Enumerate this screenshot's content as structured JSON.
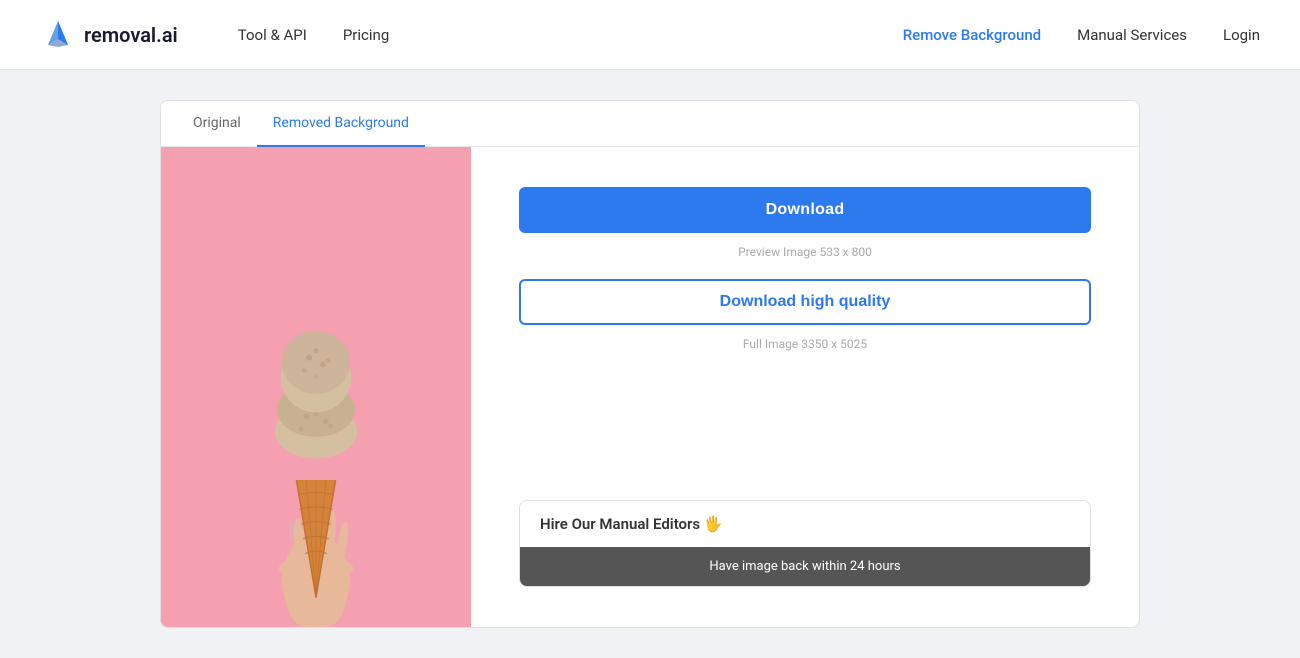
{
  "header": {
    "logo_text": "removal.ai",
    "nav_left": [
      {
        "label": "Tool & API",
        "id": "tool-api"
      },
      {
        "label": "Pricing",
        "id": "pricing"
      }
    ],
    "nav_right": [
      {
        "label": "Remove Background",
        "id": "remove-bg",
        "active": true
      },
      {
        "label": "Manual Services",
        "id": "manual-services"
      },
      {
        "label": "Login",
        "id": "login"
      }
    ]
  },
  "tabs": [
    {
      "label": "Original",
      "id": "original",
      "active": false
    },
    {
      "label": "Removed Background",
      "id": "removed-bg",
      "active": true
    }
  ],
  "right_panel": {
    "download_btn_label": "Download",
    "preview_meta": "Preview Image   533 x 800",
    "download_hq_btn_label": "Download high quality",
    "full_meta": "Full Image   3350 x 5025"
  },
  "hire_card": {
    "title": "Hire Our Manual Editors 🖐",
    "subtitle": "Have image back within 24 hours"
  },
  "colors": {
    "accent_blue": "#2d7aee",
    "pink_bg": "#f5a0b0",
    "dark_card": "#555555"
  }
}
